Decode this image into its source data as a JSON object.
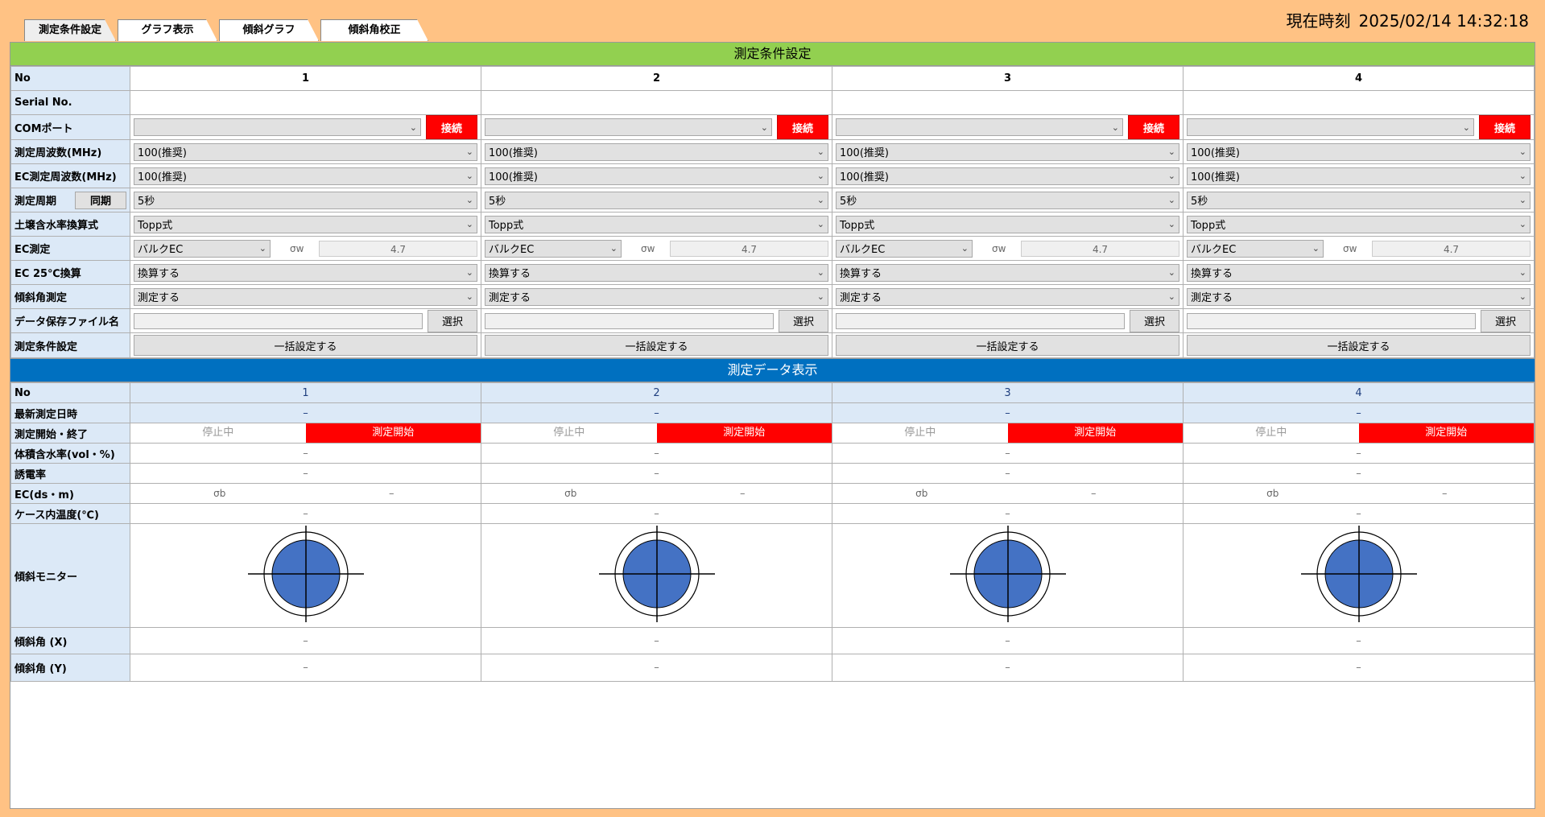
{
  "tabs": [
    "測定条件設定",
    "グラフ表示",
    "傾斜グラフ",
    "傾斜角校正"
  ],
  "clock": {
    "label": "現在時刻",
    "value": "2025/02/14 14:32:18"
  },
  "settings": {
    "title": "測定条件設定",
    "labels": {
      "no": "No",
      "serial": "Serial No.",
      "com": "COMポート",
      "freq": "測定周波数(MHz)",
      "ec_freq": "EC測定周波数(MHz)",
      "period": "測定周期",
      "sync": "同期",
      "conv": "土壌含水率換算式",
      "ec": "EC測定",
      "ec25": "EC 25℃換算",
      "tilt": "傾斜角測定",
      "file": "データ保存ファイル名",
      "cond": "測定条件設定"
    },
    "connect_label": "接続",
    "select_label": "選択",
    "apply_label": "一括設定する",
    "sigma_w_label": "σw",
    "units": [
      {
        "no": "1",
        "serial": "",
        "com": "",
        "freq": "100(推奨)",
        "ec_freq": "100(推奨)",
        "period": "5秒",
        "conv": "Topp式",
        "ec_mode": "バルクEC",
        "sigma_w": "4.7",
        "ec25": "換算する",
        "tilt": "測定する",
        "file": ""
      },
      {
        "no": "2",
        "serial": "",
        "com": "",
        "freq": "100(推奨)",
        "ec_freq": "100(推奨)",
        "period": "5秒",
        "conv": "Topp式",
        "ec_mode": "バルクEC",
        "sigma_w": "4.7",
        "ec25": "換算する",
        "tilt": "測定する",
        "file": ""
      },
      {
        "no": "3",
        "serial": "",
        "com": "",
        "freq": "100(推奨)",
        "ec_freq": "100(推奨)",
        "period": "5秒",
        "conv": "Topp式",
        "ec_mode": "バルクEC",
        "sigma_w": "4.7",
        "ec25": "換算する",
        "tilt": "測定する",
        "file": ""
      },
      {
        "no": "4",
        "serial": "",
        "com": "",
        "freq": "100(推奨)",
        "ec_freq": "100(推奨)",
        "period": "5秒",
        "conv": "Topp式",
        "ec_mode": "バルクEC",
        "sigma_w": "4.7",
        "ec25": "換算する",
        "tilt": "測定する",
        "file": ""
      }
    ]
  },
  "display": {
    "title": "測定データ表示",
    "labels": {
      "no": "No",
      "latest": "最新測定日時",
      "startstop": "測定開始・終了",
      "vwc": "体積含水率(vol・%)",
      "permittivity": "誘電率",
      "ec": "EC(ds・m)",
      "temp": "ケース内温度(℃)",
      "monitor": "傾斜モニター",
      "tilt_x": "傾斜角 (X)",
      "tilt_y": "傾斜角 (Y)"
    },
    "sigma_b_label": "σb",
    "stopped_label": "停止中",
    "start_label": "測定開始",
    "units": [
      {
        "no": "1",
        "latest": "–",
        "vwc": "–",
        "permittivity": "–",
        "ec": "–",
        "temp": "–",
        "tilt_x": "–",
        "tilt_y": "–"
      },
      {
        "no": "2",
        "latest": "–",
        "vwc": "–",
        "permittivity": "–",
        "ec": "–",
        "temp": "–",
        "tilt_x": "–",
        "tilt_y": "–"
      },
      {
        "no": "3",
        "latest": "–",
        "vwc": "–",
        "permittivity": "–",
        "ec": "–",
        "temp": "–",
        "tilt_x": "–",
        "tilt_y": "–"
      },
      {
        "no": "4",
        "latest": "–",
        "vwc": "–",
        "permittivity": "–",
        "ec": "–",
        "temp": "–",
        "tilt_x": "–",
        "tilt_y": "–"
      }
    ]
  },
  "colors": {
    "accent_green": "#92D050",
    "accent_blue": "#0070C0",
    "alert_red": "#FF0000",
    "bubble_blue": "#4472C4",
    "background": "#FFC284"
  }
}
